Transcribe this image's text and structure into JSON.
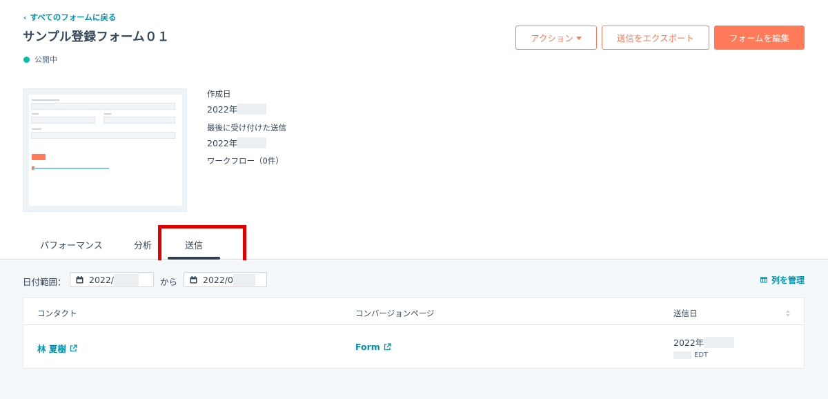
{
  "header": {
    "back_link": "すべてのフォームに戻る",
    "title": "サンプル登録フォーム０１",
    "status": "公開中",
    "actions": {
      "actions_label": "アクション",
      "export_label": "送信をエクスポート",
      "edit_label": "フォームを編集"
    }
  },
  "details": {
    "created_label": "作成日",
    "created_value": "2022年",
    "last_submission_label": "最後に受け付けた送信",
    "last_submission_value": "2022年",
    "workflows_label": "ワークフロー（0件）"
  },
  "tabs": [
    {
      "label": "パフォーマンス",
      "active": false
    },
    {
      "label": "分析",
      "active": false
    },
    {
      "label": "送信",
      "active": true
    }
  ],
  "filters": {
    "range_label": "日付範囲：",
    "from_value": "2022/",
    "separator": "から",
    "to_value": "2022/0",
    "manage_columns": "列を管理"
  },
  "table": {
    "columns": [
      "コンタクト",
      "コンバージョンページ",
      "送信日"
    ],
    "rows": [
      {
        "contact": "林 夏樹",
        "page": "Form",
        "date": "2022年",
        "tz": "EDT"
      }
    ]
  },
  "colors": {
    "accent": "#ff7a59",
    "link": "#0091ae",
    "status": "#00bda5",
    "highlight": "#e00000"
  }
}
